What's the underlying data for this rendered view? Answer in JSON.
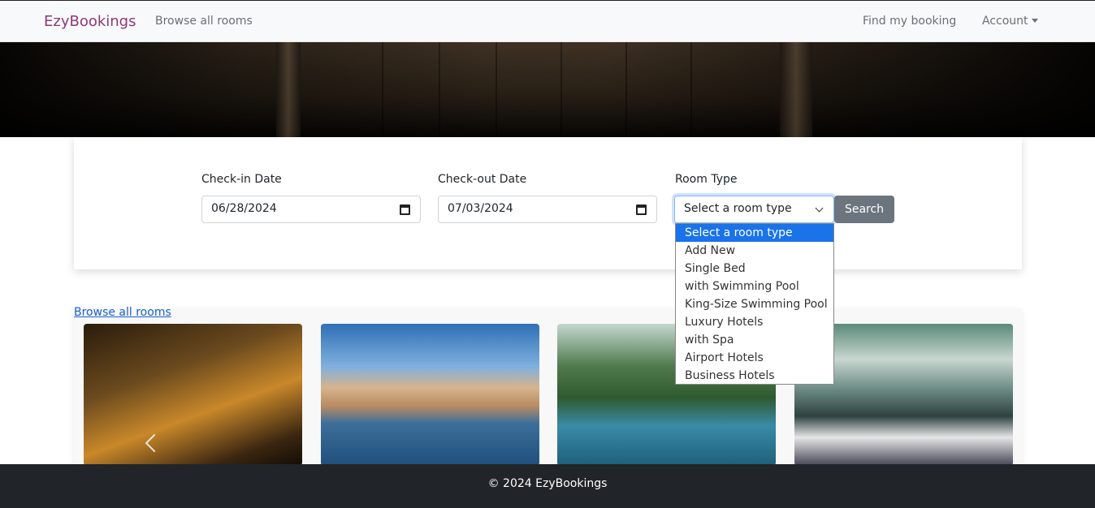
{
  "navbar": {
    "brand": "EzyBookings",
    "browse_label": "Browse all rooms",
    "find_label": "Find my booking",
    "account_label": "Account"
  },
  "search": {
    "checkin_label": "Check-in Date",
    "checkin_value": "06/28/2024",
    "checkout_label": "Check-out Date",
    "checkout_value": "07/03/2024",
    "roomtype_label": "Room Type",
    "roomtype_value": "Select a room type",
    "search_button": "Search"
  },
  "dropdown": {
    "options": [
      "Select a room type",
      "Add New",
      "Single Bed",
      "with Swimming Pool",
      "King-Size Swimming Pool",
      "Luxury Hotels",
      "with Spa",
      "Airport Hotels",
      "Business Hotels"
    ],
    "selected_index": 0
  },
  "browse": {
    "link_label": "Browse all rooms"
  },
  "footer": {
    "text": "© 2024 EzyBookings"
  },
  "colors": {
    "brand": "#8b3a78",
    "selected_option": "#1a73e8",
    "search_button": "#6c757d",
    "footer_bg": "#212529"
  }
}
